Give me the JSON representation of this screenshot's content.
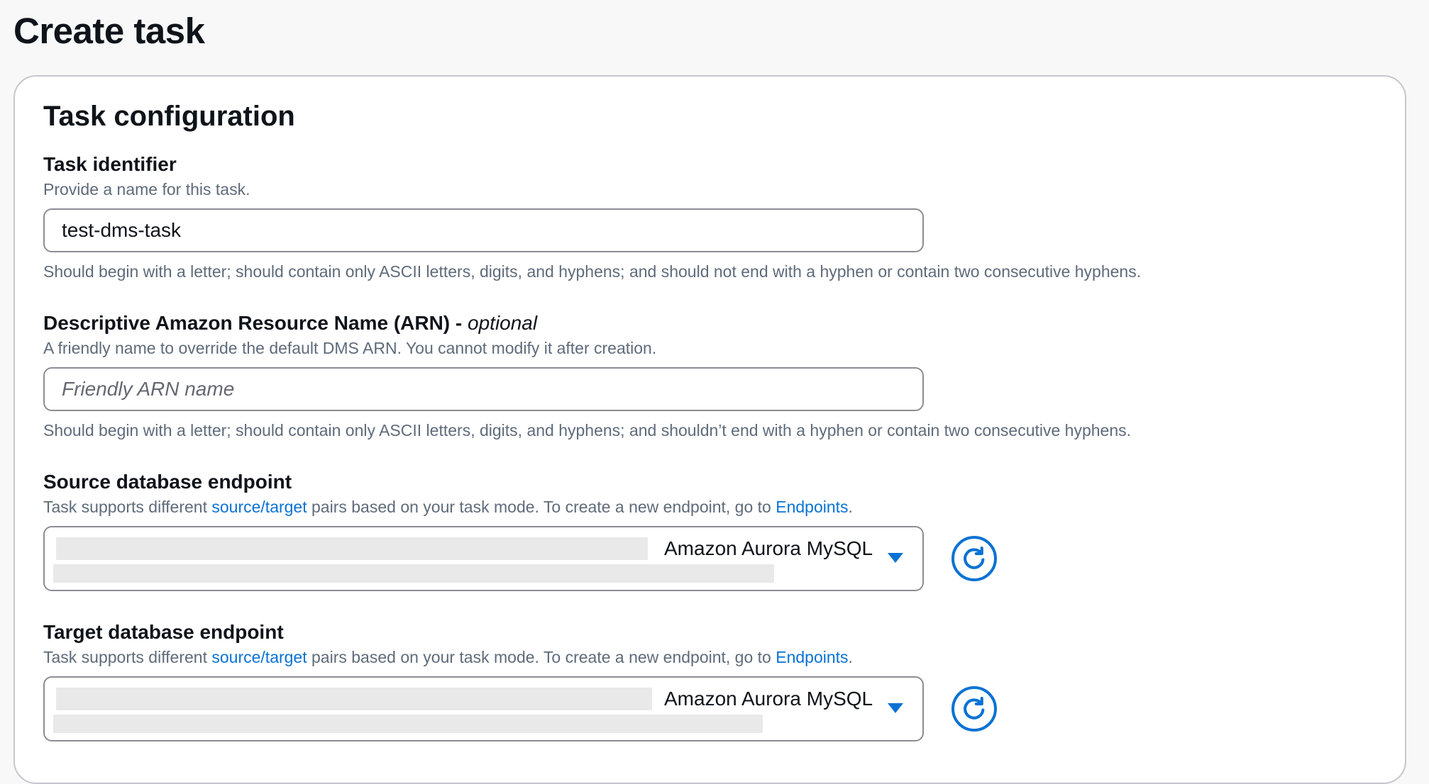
{
  "page": {
    "title": "Create task"
  },
  "panel": {
    "title": "Task configuration"
  },
  "task_identifier": {
    "label": "Task identifier",
    "description": "Provide a name for this task.",
    "value": "test-dms-task",
    "constraint": "Should begin with a letter; should contain only ASCII letters, digits, and hyphens; and should not end with a hyphen or contain two consecutive hyphens."
  },
  "arn": {
    "label": "Descriptive Amazon Resource Name (ARN)",
    "label_separator": " - ",
    "label_optional": "optional",
    "description": "A friendly name to override the default DMS ARN. You cannot modify it after creation.",
    "placeholder": "Friendly ARN name",
    "constraint": "Should begin with a letter; should contain only ASCII letters, digits, and hyphens; and shouldn’t end with a hyphen or contain two consecutive hyphens."
  },
  "source_endpoint": {
    "label": "Source database endpoint",
    "description_prefix": "Task supports different ",
    "description_link": "source/target",
    "description_middle": " pairs based on your task mode. To create a new endpoint, go to ",
    "description_link2": "Endpoints",
    "description_suffix": ".",
    "engine": "Amazon Aurora MySQL",
    "refresh_icon": "refresh-icon",
    "caret_icon": "caret-down-icon"
  },
  "target_endpoint": {
    "label": "Target database endpoint",
    "description_prefix": "Task supports different ",
    "description_link": "source/target",
    "description_middle": " pairs based on your task mode. To create a new endpoint, go to ",
    "description_link2": "Endpoints",
    "description_suffix": ".",
    "engine": "Amazon Aurora MySQL",
    "refresh_icon": "refresh-icon",
    "caret_icon": "caret-down-icon"
  },
  "colors": {
    "link": "#0972d3",
    "text": "#0f141a",
    "secondary_text": "#5f6b7a",
    "input_border": "#8c8c94",
    "redaction": "#e9e9e9"
  }
}
